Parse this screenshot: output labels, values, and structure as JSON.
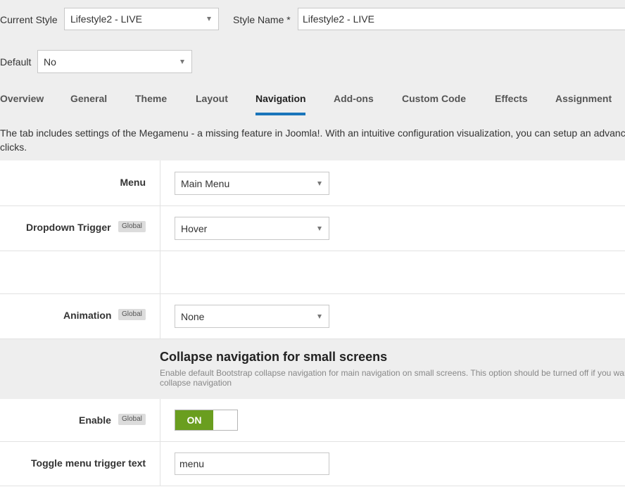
{
  "header": {
    "current_style_label": "Current Style",
    "current_style_value": "Lifestyle2 - LIVE",
    "style_name_label": "Style Name *",
    "style_name_value": "Lifestyle2 - LIVE",
    "default_label": "Default",
    "default_value": "No"
  },
  "tabs": [
    {
      "label": "Overview"
    },
    {
      "label": "General"
    },
    {
      "label": "Theme"
    },
    {
      "label": "Layout"
    },
    {
      "label": "Navigation",
      "active": true
    },
    {
      "label": "Add-ons"
    },
    {
      "label": "Custom Code"
    },
    {
      "label": "Effects"
    },
    {
      "label": "Assignment"
    }
  ],
  "description": {
    "line1": "The tab includes settings of the Megamenu - a missing feature in Joomla!. With an intuitive configuration visualization, you can setup an advanced",
    "line2": "clicks."
  },
  "settings": {
    "menu": {
      "label": "Menu",
      "value": "Main Menu"
    },
    "dropdown_trigger": {
      "label": "Dropdown Trigger",
      "badge": "Global",
      "value": "Hover"
    },
    "animation": {
      "label": "Animation",
      "badge": "Global",
      "value": "None"
    }
  },
  "collapse_section": {
    "title": "Collapse navigation for small screens",
    "desc_line1": "Enable default Bootstrap collapse navigation for main navigation on small screens. This option should be turned off if you want to use",
    "desc_line2": "collapse navigation",
    "enable": {
      "label": "Enable",
      "badge": "Global",
      "toggle_text": "ON",
      "value": true
    },
    "toggle_text_field": {
      "label": "Toggle menu trigger text",
      "value": "menu"
    }
  },
  "colors": {
    "accent_tab_underline": "#1a75bb",
    "toggle_on": "#6a9e1f"
  }
}
